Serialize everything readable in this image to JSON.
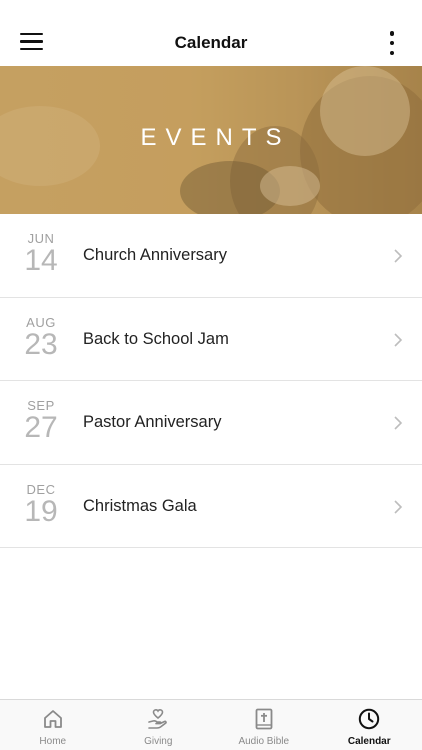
{
  "header": {
    "title": "Calendar",
    "menu_icon": "hamburger-menu-icon",
    "more_icon": "vertical-dots-icon"
  },
  "hero": {
    "title": "EVENTS"
  },
  "events": [
    {
      "month": "JUN",
      "day": "14",
      "title": "Church Anniversary"
    },
    {
      "month": "AUG",
      "day": "23",
      "title": "Back to School Jam"
    },
    {
      "month": "SEP",
      "day": "27",
      "title": "Pastor Anniversary"
    },
    {
      "month": "DEC",
      "day": "19",
      "title": "Christmas Gala"
    }
  ],
  "tabs": [
    {
      "label": "Home",
      "icon": "home-icon",
      "active": false
    },
    {
      "label": "Giving",
      "icon": "giving-hand-heart-icon",
      "active": false
    },
    {
      "label": "Audio Bible",
      "icon": "bible-cross-icon",
      "active": false
    },
    {
      "label": "Calendar",
      "icon": "clock-icon",
      "active": true
    }
  ],
  "colors": {
    "hero_tint": "#c9a466",
    "active_tab": "#111111",
    "inactive_tab": "#8a8a8a"
  }
}
